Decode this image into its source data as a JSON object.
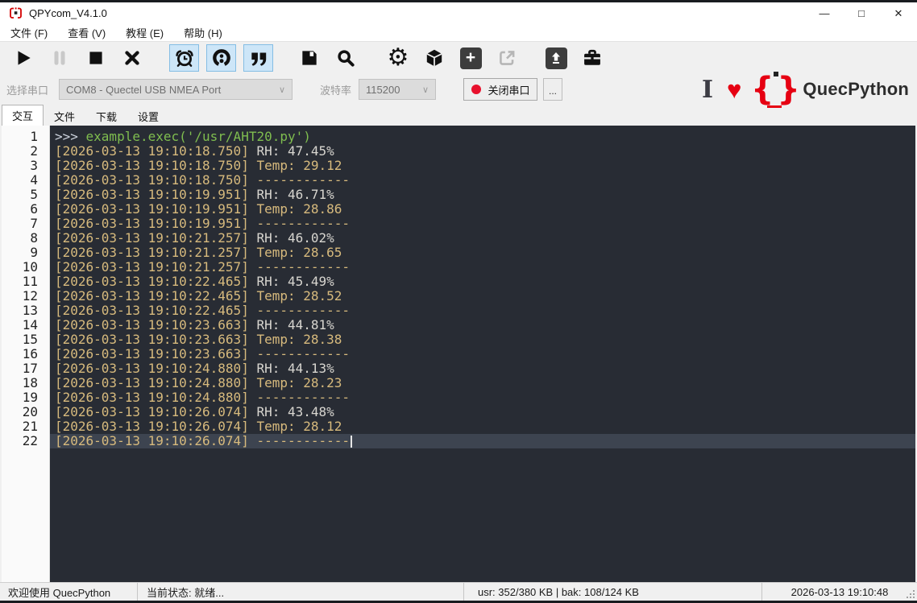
{
  "window": {
    "title": "QPYcom_V4.1.0",
    "minimize": "—",
    "maximize": "□",
    "close": "✕"
  },
  "menu": {
    "items": [
      {
        "key": "file",
        "label": "文件 (F)"
      },
      {
        "key": "view",
        "label": "查看 (V)"
      },
      {
        "key": "tutorial",
        "label": "教程 (E)"
      },
      {
        "key": "help",
        "label": "帮助 (H)"
      }
    ]
  },
  "toolbar": {
    "buttons": [
      {
        "name": "run-button",
        "icon": "play-icon",
        "state": "enabled"
      },
      {
        "name": "pause-button",
        "icon": "pause-icon",
        "state": "disabled"
      },
      {
        "name": "stop-button",
        "icon": "stop-icon",
        "state": "enabled"
      },
      {
        "name": "close-button",
        "icon": "x-icon",
        "state": "enabled"
      },
      {
        "name": "timestamp-toggle-button",
        "icon": "alarm-clock-icon",
        "state": "toggled-on"
      },
      {
        "name": "record-toggle-button",
        "icon": "open-ring-8-icon",
        "state": "toggled-on"
      },
      {
        "name": "quote-toggle-button",
        "icon": "double-quote-icon",
        "state": "toggled-on"
      },
      {
        "name": "save-button",
        "icon": "floppy-icon",
        "state": "enabled"
      },
      {
        "name": "search-button",
        "icon": "magnifier-icon",
        "state": "enabled"
      },
      {
        "name": "settings-button",
        "icon": "gear-icon",
        "state": "enabled"
      },
      {
        "name": "package-button",
        "icon": "cube-icon",
        "state": "enabled"
      },
      {
        "name": "add-button",
        "icon": "plus-icon",
        "state": "enabled"
      },
      {
        "name": "export-button",
        "icon": "share-arrow-icon",
        "state": "disabled"
      },
      {
        "name": "upload-button",
        "icon": "upload-arrow-icon",
        "state": "enabled"
      },
      {
        "name": "toolbox-button",
        "icon": "toolbox-icon",
        "state": "enabled"
      }
    ],
    "plus_glyph": "+"
  },
  "serial": {
    "port_label": "选择串口",
    "port_value": "COM8 - Quectel USB NMEA Port",
    "baud_label": "波特率",
    "baud_value": "115200",
    "close_button_label": "关闭串口",
    "status_dot_color": "#e8112d",
    "more_button_label": "...",
    "chevron": "∨"
  },
  "brand": {
    "ibeam": "I",
    "heart": "♥",
    "name": "QuecPython",
    "accent": "#e60012"
  },
  "tabs": [
    {
      "key": "interact",
      "label": "交互",
      "active": true
    },
    {
      "key": "file",
      "label": "文件",
      "active": false
    },
    {
      "key": "download",
      "label": "下载",
      "active": false
    },
    {
      "key": "settings",
      "label": "设置",
      "active": false
    }
  ],
  "terminal": {
    "colors": {
      "background": "#282c34",
      "current_line": "#3d4450",
      "prompt": "#ccd2dc",
      "code": "#7fbd4f",
      "timestamp": "#d7ba7d",
      "rh_value": "#d8d6d0",
      "temp_value": "#d7ba7d"
    },
    "lines": [
      {
        "n": 1,
        "segs": [
          {
            "t": ">>> ",
            "c": "prompt"
          },
          {
            "t": "example.exec('/usr/AHT20.py')",
            "c": "code"
          }
        ]
      },
      {
        "n": 2,
        "segs": [
          {
            "t": "[2026-03-13 19:10:18.750] ",
            "c": "ts"
          },
          {
            "t": "RH: 47.45%",
            "c": "val"
          }
        ]
      },
      {
        "n": 3,
        "segs": [
          {
            "t": "[2026-03-13 19:10:18.750] ",
            "c": "ts"
          },
          {
            "t": "Temp: 29.12",
            "c": "temp"
          }
        ]
      },
      {
        "n": 4,
        "segs": [
          {
            "t": "[2026-03-13 19:10:18.750] ",
            "c": "ts"
          },
          {
            "t": "------------",
            "c": "dash"
          }
        ]
      },
      {
        "n": 5,
        "segs": [
          {
            "t": "[2026-03-13 19:10:19.951] ",
            "c": "ts"
          },
          {
            "t": "RH: 46.71%",
            "c": "val"
          }
        ]
      },
      {
        "n": 6,
        "segs": [
          {
            "t": "[2026-03-13 19:10:19.951] ",
            "c": "ts"
          },
          {
            "t": "Temp: 28.86",
            "c": "temp"
          }
        ]
      },
      {
        "n": 7,
        "segs": [
          {
            "t": "[2026-03-13 19:10:19.951] ",
            "c": "ts"
          },
          {
            "t": "------------",
            "c": "dash"
          }
        ]
      },
      {
        "n": 8,
        "segs": [
          {
            "t": "[2026-03-13 19:10:21.257] ",
            "c": "ts"
          },
          {
            "t": "RH: 46.02%",
            "c": "val"
          }
        ]
      },
      {
        "n": 9,
        "segs": [
          {
            "t": "[2026-03-13 19:10:21.257] ",
            "c": "ts"
          },
          {
            "t": "Temp: 28.65",
            "c": "temp"
          }
        ]
      },
      {
        "n": 10,
        "segs": [
          {
            "t": "[2026-03-13 19:10:21.257] ",
            "c": "ts"
          },
          {
            "t": "------------",
            "c": "dash"
          }
        ]
      },
      {
        "n": 11,
        "segs": [
          {
            "t": "[2026-03-13 19:10:22.465] ",
            "c": "ts"
          },
          {
            "t": "RH: 45.49%",
            "c": "val"
          }
        ]
      },
      {
        "n": 12,
        "segs": [
          {
            "t": "[2026-03-13 19:10:22.465] ",
            "c": "ts"
          },
          {
            "t": "Temp: 28.52",
            "c": "temp"
          }
        ]
      },
      {
        "n": 13,
        "segs": [
          {
            "t": "[2026-03-13 19:10:22.465] ",
            "c": "ts"
          },
          {
            "t": "------------",
            "c": "dash"
          }
        ]
      },
      {
        "n": 14,
        "segs": [
          {
            "t": "[2026-03-13 19:10:23.663] ",
            "c": "ts"
          },
          {
            "t": "RH: 44.81%",
            "c": "val"
          }
        ]
      },
      {
        "n": 15,
        "segs": [
          {
            "t": "[2026-03-13 19:10:23.663] ",
            "c": "ts"
          },
          {
            "t": "Temp: 28.38",
            "c": "temp"
          }
        ]
      },
      {
        "n": 16,
        "segs": [
          {
            "t": "[2026-03-13 19:10:23.663] ",
            "c": "ts"
          },
          {
            "t": "------------",
            "c": "dash"
          }
        ]
      },
      {
        "n": 17,
        "segs": [
          {
            "t": "[2026-03-13 19:10:24.880] ",
            "c": "ts"
          },
          {
            "t": "RH: 44.13%",
            "c": "val"
          }
        ]
      },
      {
        "n": 18,
        "segs": [
          {
            "t": "[2026-03-13 19:10:24.880] ",
            "c": "ts"
          },
          {
            "t": "Temp: 28.23",
            "c": "temp"
          }
        ]
      },
      {
        "n": 19,
        "segs": [
          {
            "t": "[2026-03-13 19:10:24.880] ",
            "c": "ts"
          },
          {
            "t": "------------",
            "c": "dash"
          }
        ]
      },
      {
        "n": 20,
        "segs": [
          {
            "t": "[2026-03-13 19:10:26.074] ",
            "c": "ts"
          },
          {
            "t": "RH: 43.48%",
            "c": "val"
          }
        ]
      },
      {
        "n": 21,
        "segs": [
          {
            "t": "[2026-03-13 19:10:26.074] ",
            "c": "ts"
          },
          {
            "t": "Temp: 28.12",
            "c": "temp"
          }
        ]
      },
      {
        "n": 22,
        "segs": [
          {
            "t": "[2026-03-13 19:10:26.074] ",
            "c": "ts"
          },
          {
            "t": "------------",
            "c": "dash"
          }
        ],
        "current": true,
        "cursor": true
      }
    ]
  },
  "status_bar": {
    "welcome": "欢迎使用 QuecPython",
    "state": "当前状态: 就绪...",
    "storage": "usr: 352/380 KB | bak: 108/124 KB",
    "datetime": "2026-03-13 19:10:48"
  }
}
